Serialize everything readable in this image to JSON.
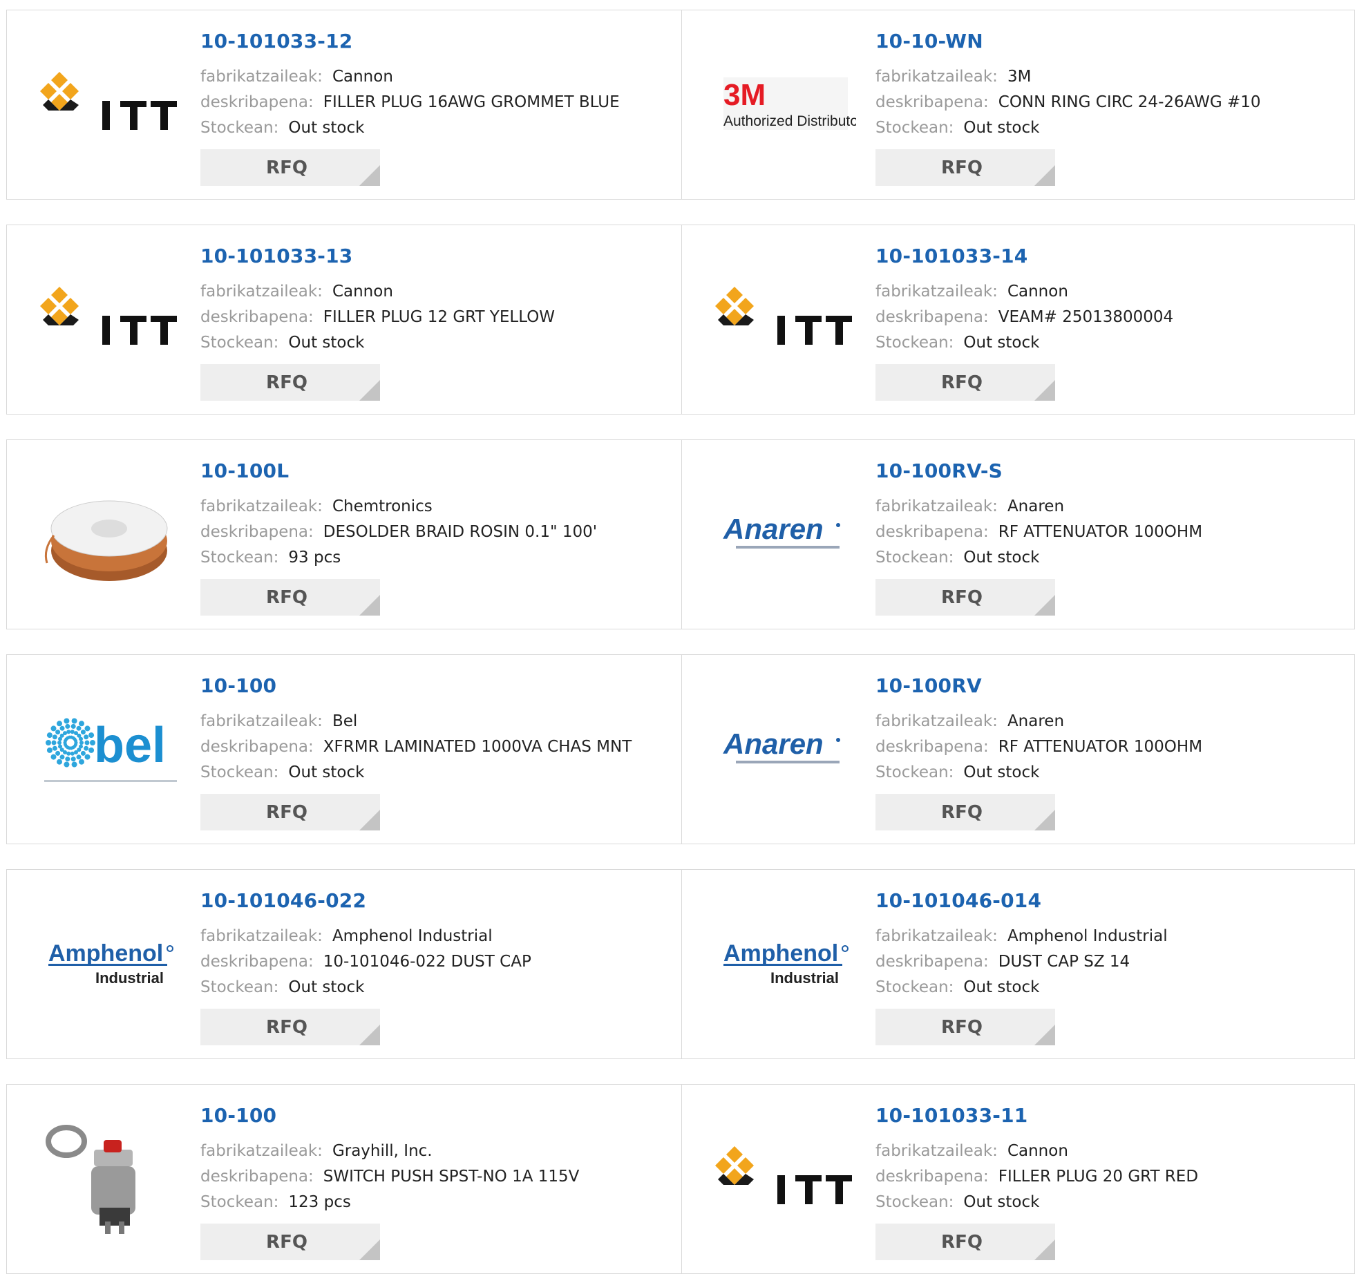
{
  "labels": {
    "manufacturer": "fabrikatzaileak:",
    "description": "deskribapena:",
    "stock": "Stockean:",
    "rfq": "RFQ"
  },
  "colors": {
    "part_link": "#1c63b0",
    "label": "#9a9a9a",
    "rfq_bg": "#eeeeee"
  },
  "products": [
    {
      "part": "10-101033-12",
      "manufacturer": "Cannon",
      "description": "FILLER PLUG 16AWG GROMMET BLUE",
      "stock": "Out stock",
      "logo": "itt-logo"
    },
    {
      "part": "10-10-WN",
      "manufacturer": "3M",
      "description": "CONN RING CIRC 24-26AWG #10",
      "stock": "Out stock",
      "logo": "3m-logo",
      "logo_text": [
        "3M",
        "Authorized Distributor"
      ]
    },
    {
      "part": "10-101033-13",
      "manufacturer": "Cannon",
      "description": "FILLER PLUG 12 GRT YELLOW",
      "stock": "Out stock",
      "logo": "itt-logo"
    },
    {
      "part": "10-101033-14",
      "manufacturer": "Cannon",
      "description": "VEAM# 25013800004",
      "stock": "Out stock",
      "logo": "itt-logo"
    },
    {
      "part": "10-100L",
      "manufacturer": "Chemtronics",
      "description": "DESOLDER BRAID ROSIN 0.1\" 100'",
      "stock": "93 pcs",
      "logo": "braid-spool-photo"
    },
    {
      "part": "10-100RV-S",
      "manufacturer": "Anaren",
      "description": "RF ATTENUATOR 100OHM",
      "stock": "Out stock",
      "logo": "anaren-logo"
    },
    {
      "part": "10-100",
      "manufacturer": "Bel",
      "description": "XFRMR LAMINATED 1000VA CHAS MNT",
      "stock": "Out stock",
      "logo": "bel-logo"
    },
    {
      "part": "10-100RV",
      "manufacturer": "Anaren",
      "description": "RF ATTENUATOR 100OHM",
      "stock": "Out stock",
      "logo": "anaren-logo"
    },
    {
      "part": "10-101046-022",
      "manufacturer": "Amphenol Industrial",
      "description": "10-101046-022 DUST CAP",
      "stock": "Out stock",
      "logo": "amphenol-logo"
    },
    {
      "part": "10-101046-014",
      "manufacturer": "Amphenol Industrial",
      "description": "DUST CAP SZ 14",
      "stock": "Out stock",
      "logo": "amphenol-logo"
    },
    {
      "part": "10-100",
      "manufacturer": "Grayhill, Inc.",
      "description": "SWITCH PUSH SPST-NO 1A 115V",
      "stock": "123 pcs",
      "logo": "push-switch-photo"
    },
    {
      "part": "10-101033-11",
      "manufacturer": "Cannon",
      "description": "FILLER PLUG 20 GRT RED",
      "stock": "Out stock",
      "logo": "itt-logo"
    }
  ]
}
